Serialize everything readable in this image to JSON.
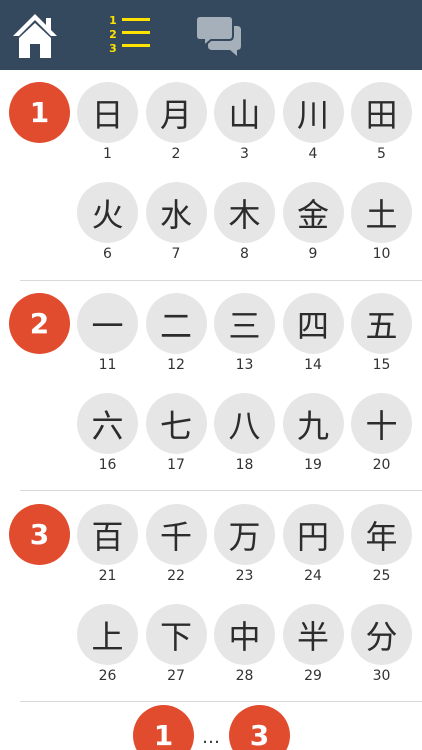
{
  "toolbar": {
    "home_icon": "home-icon",
    "list_icon": "numbered-list-icon",
    "list_numbers": [
      "1",
      "2",
      "3"
    ],
    "chat_icon": "chat-bubbles-icon",
    "bar_color": "#34495e",
    "accent_color": "#ffe200"
  },
  "lessons": [
    {
      "badge": "1",
      "kanji": [
        {
          "char": "日",
          "num": "1"
        },
        {
          "char": "月",
          "num": "2"
        },
        {
          "char": "山",
          "num": "3"
        },
        {
          "char": "川",
          "num": "4"
        },
        {
          "char": "田",
          "num": "5"
        },
        {
          "char": "火",
          "num": "6"
        },
        {
          "char": "水",
          "num": "7"
        },
        {
          "char": "木",
          "num": "8"
        },
        {
          "char": "金",
          "num": "9"
        },
        {
          "char": "土",
          "num": "10"
        }
      ]
    },
    {
      "badge": "2",
      "kanji": [
        {
          "char": "一",
          "num": "11"
        },
        {
          "char": "二",
          "num": "12"
        },
        {
          "char": "三",
          "num": "13"
        },
        {
          "char": "四",
          "num": "14"
        },
        {
          "char": "五",
          "num": "15"
        },
        {
          "char": "六",
          "num": "16"
        },
        {
          "char": "七",
          "num": "17"
        },
        {
          "char": "八",
          "num": "18"
        },
        {
          "char": "九",
          "num": "19"
        },
        {
          "char": "十",
          "num": "20"
        }
      ]
    },
    {
      "badge": "3",
      "kanji": [
        {
          "char": "百",
          "num": "21"
        },
        {
          "char": "千",
          "num": "22"
        },
        {
          "char": "万",
          "num": "23"
        },
        {
          "char": "円",
          "num": "24"
        },
        {
          "char": "年",
          "num": "25"
        },
        {
          "char": "上",
          "num": "26"
        },
        {
          "char": "下",
          "num": "27"
        },
        {
          "char": "中",
          "num": "28"
        },
        {
          "char": "半",
          "num": "29"
        },
        {
          "char": "分",
          "num": "30"
        }
      ]
    }
  ],
  "pager": {
    "first": "1",
    "ellipsis": "…",
    "last": "3"
  }
}
